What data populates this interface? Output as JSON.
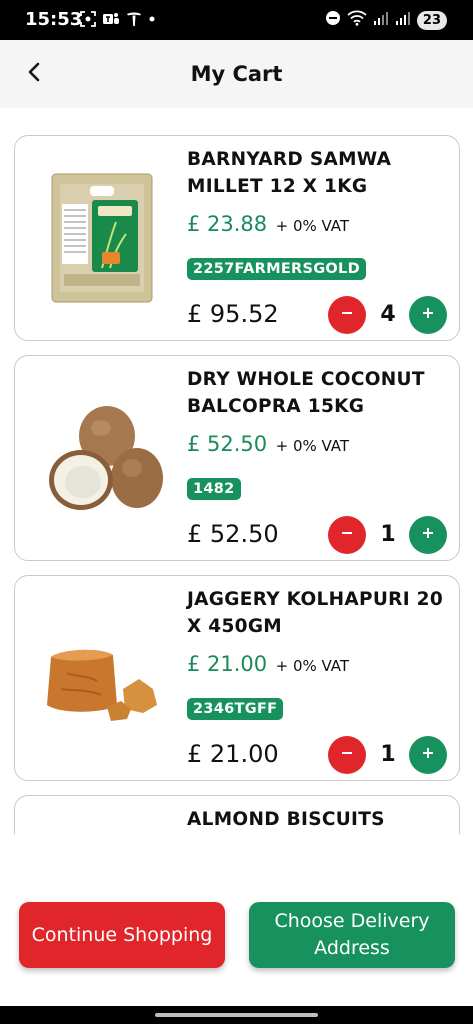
{
  "status_bar": {
    "time": "15:53",
    "notification_count": "23",
    "icons": [
      "screenshot-icon",
      "teams-icon",
      "tesla-icon",
      "dot-icon",
      "dnd-icon",
      "wifi-icon",
      "signal-icon",
      "signal-icon"
    ]
  },
  "header": {
    "title": "My Cart",
    "back_icon": "chevron-left-icon"
  },
  "cart": {
    "items": [
      {
        "name": "BARNYARD SAMWA MILLET 12 X 1KG",
        "unit_price": "£ 23.88",
        "vat": "+ 0% VAT",
        "code": "2257FARMERSGOLD",
        "total": "£ 95.52",
        "quantity": "4",
        "image": "millet-bag-image"
      },
      {
        "name": "DRY WHOLE COCONUT BALCOPRA 15KG",
        "unit_price": "£ 52.50",
        "vat": "+ 0% VAT",
        "code": "1482",
        "total": "£ 52.50",
        "quantity": "1",
        "image": "coconut-image"
      },
      {
        "name": "JAGGERY KOLHAPURI 20 X 450GM",
        "unit_price": "£ 21.00",
        "vat": "+ 0% VAT",
        "code": "2346TGFF",
        "total": "£ 21.00",
        "quantity": "1",
        "image": "jaggery-image"
      },
      {
        "name": "ALMOND BISCUITS"
      }
    ]
  },
  "actions": {
    "continue_label": "Continue Shopping",
    "delivery_label": "Choose Delivery Address"
  },
  "colors": {
    "accent_green": "#17925f",
    "accent_red": "#e0262a"
  }
}
